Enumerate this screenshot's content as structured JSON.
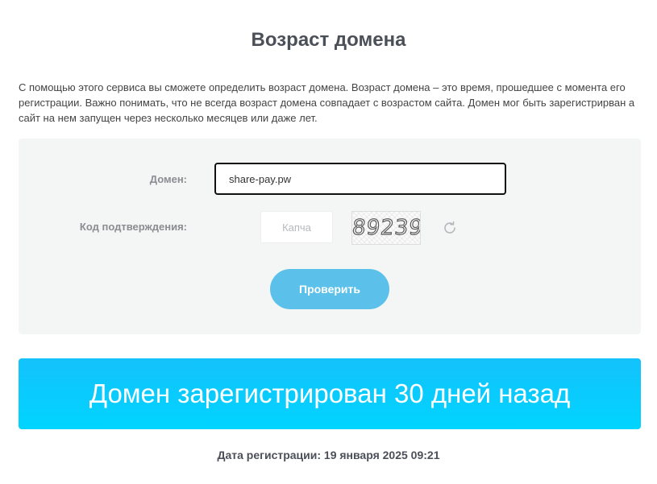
{
  "page": {
    "title": "Возраст домена",
    "intro": "С помощью этого сервиса вы сможете определить возраст домена. Возраст домена – это время, прошедшее с момента его регистрации. Важно понимать, что не всегда возраст домена совпадает с возрастом сайта. Домен мог быть зарегистрирван а сайт на нем запущен через несколько месяцев или даже лет."
  },
  "form": {
    "domain_label": "Домен:",
    "domain_value": "share-pay.pw",
    "captcha_label": "Код подтверждения:",
    "captcha_placeholder": "Капча",
    "captcha_code": "89239",
    "submit_label": "Проверить",
    "refresh_icon": "refresh-icon"
  },
  "result": {
    "message": "Домен зарегистрирован 30 дней назад",
    "registration_date": "Дата регистрации: 19 января 2025 09:21"
  },
  "colors": {
    "button": "#5bc1ea",
    "banner": "#00c8fc",
    "panel": "#f4f5f5",
    "title": "#4b4f58"
  }
}
